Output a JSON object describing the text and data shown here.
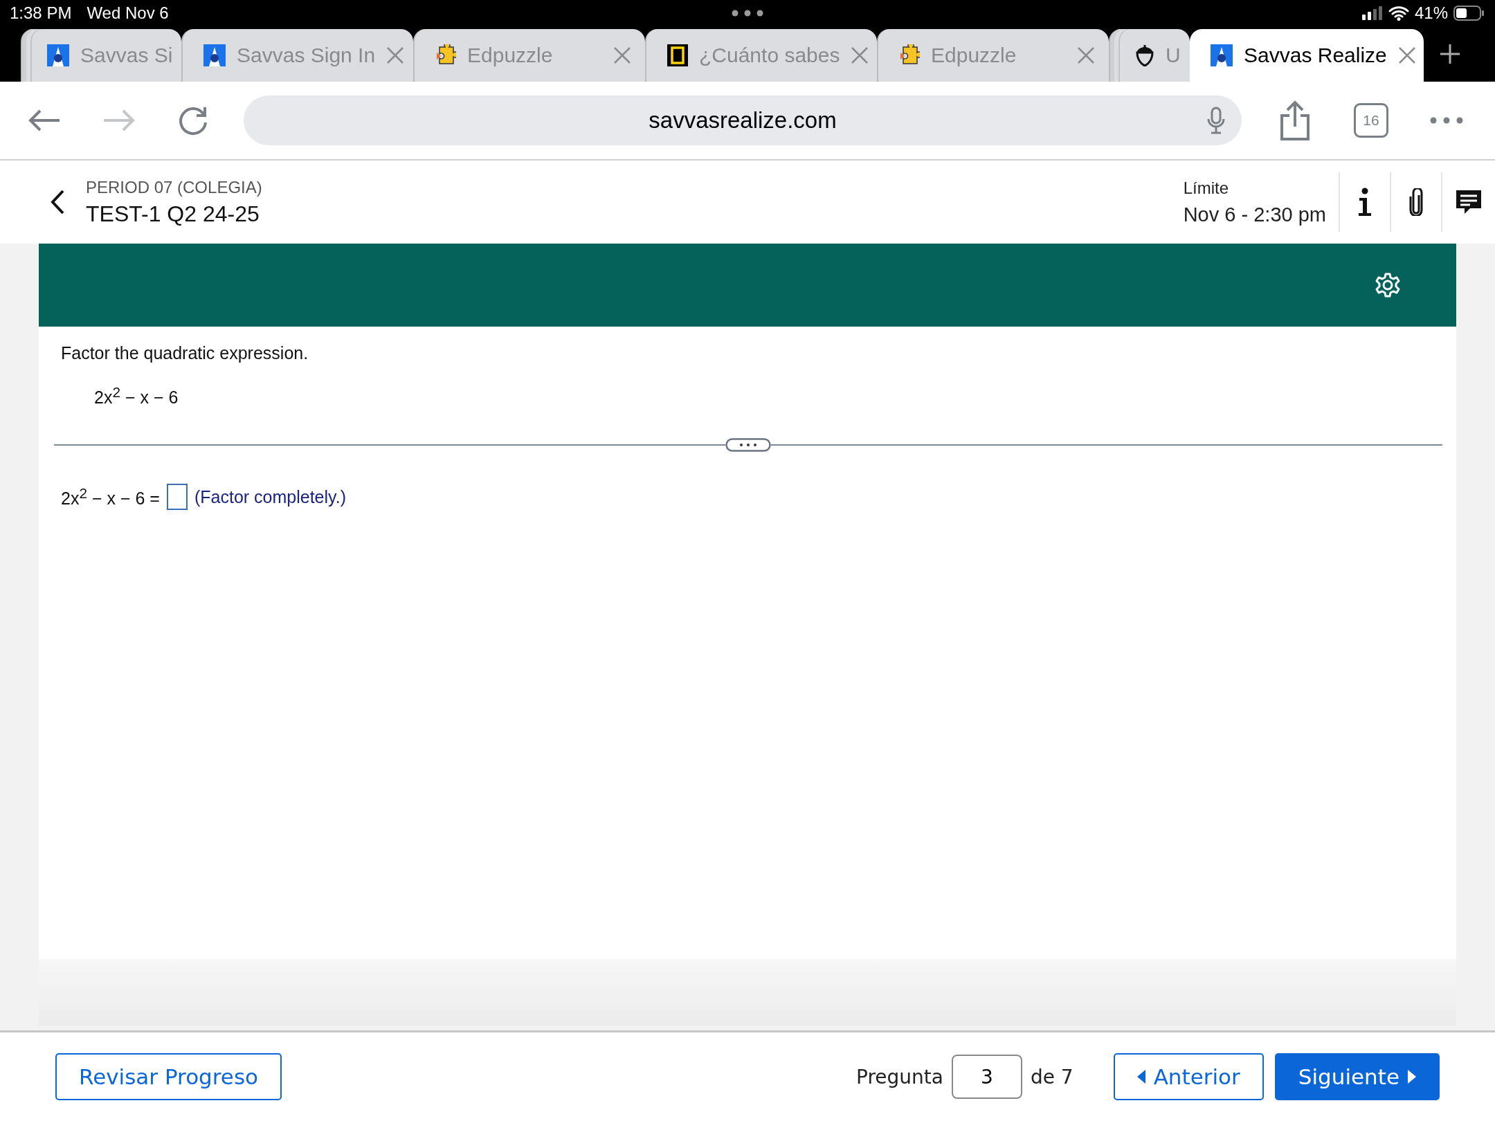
{
  "status_bar": {
    "time": "1:38 PM",
    "date": "Wed Nov 6",
    "battery": "41%"
  },
  "tabs": [
    {
      "label": "Savvas Si",
      "kind": "savvas",
      "compact": true,
      "closable": false,
      "selected": false
    },
    {
      "label": "Savvas Sign In",
      "kind": "savvas",
      "compact": false,
      "closable": true,
      "selected": false
    },
    {
      "label": "Edpuzzle",
      "kind": "edpuzzle",
      "compact": false,
      "closable": true,
      "selected": false
    },
    {
      "label": "¿Cuánto sabes",
      "kind": "frame",
      "compact": false,
      "closable": true,
      "selected": false
    },
    {
      "label": "Edpuzzle",
      "kind": "edpuzzle",
      "compact": false,
      "closable": true,
      "selected": false
    },
    {
      "label": "U",
      "kind": "acorn",
      "compact": true,
      "closable": false,
      "selected": false
    },
    {
      "label": "Savvas Realize",
      "kind": "savvas",
      "compact": false,
      "closable": true,
      "selected": true
    }
  ],
  "address_bar": {
    "url": "savvasrealize.com",
    "tab_count": "16"
  },
  "header": {
    "class_name": "PERIOD 07 (COLEGIA)",
    "assignment": "TEST-1 Q2 24-25",
    "due_label": "Límite",
    "due_date": "Nov 6 - 2:30 pm"
  },
  "question": {
    "prompt": "Factor the quadratic expression.",
    "expression": "2x$^{2}$ − x − 6",
    "answer_lead": "2x$^{2}$ − x − 6 =",
    "answer_hint": "(Factor completely.)"
  },
  "footer": {
    "review_button": "Revisar Progreso",
    "question_label": "Pregunta",
    "question_number": "3",
    "question_total": "de 7",
    "previous_button": "Anterior",
    "next_button": "Siguiente"
  }
}
